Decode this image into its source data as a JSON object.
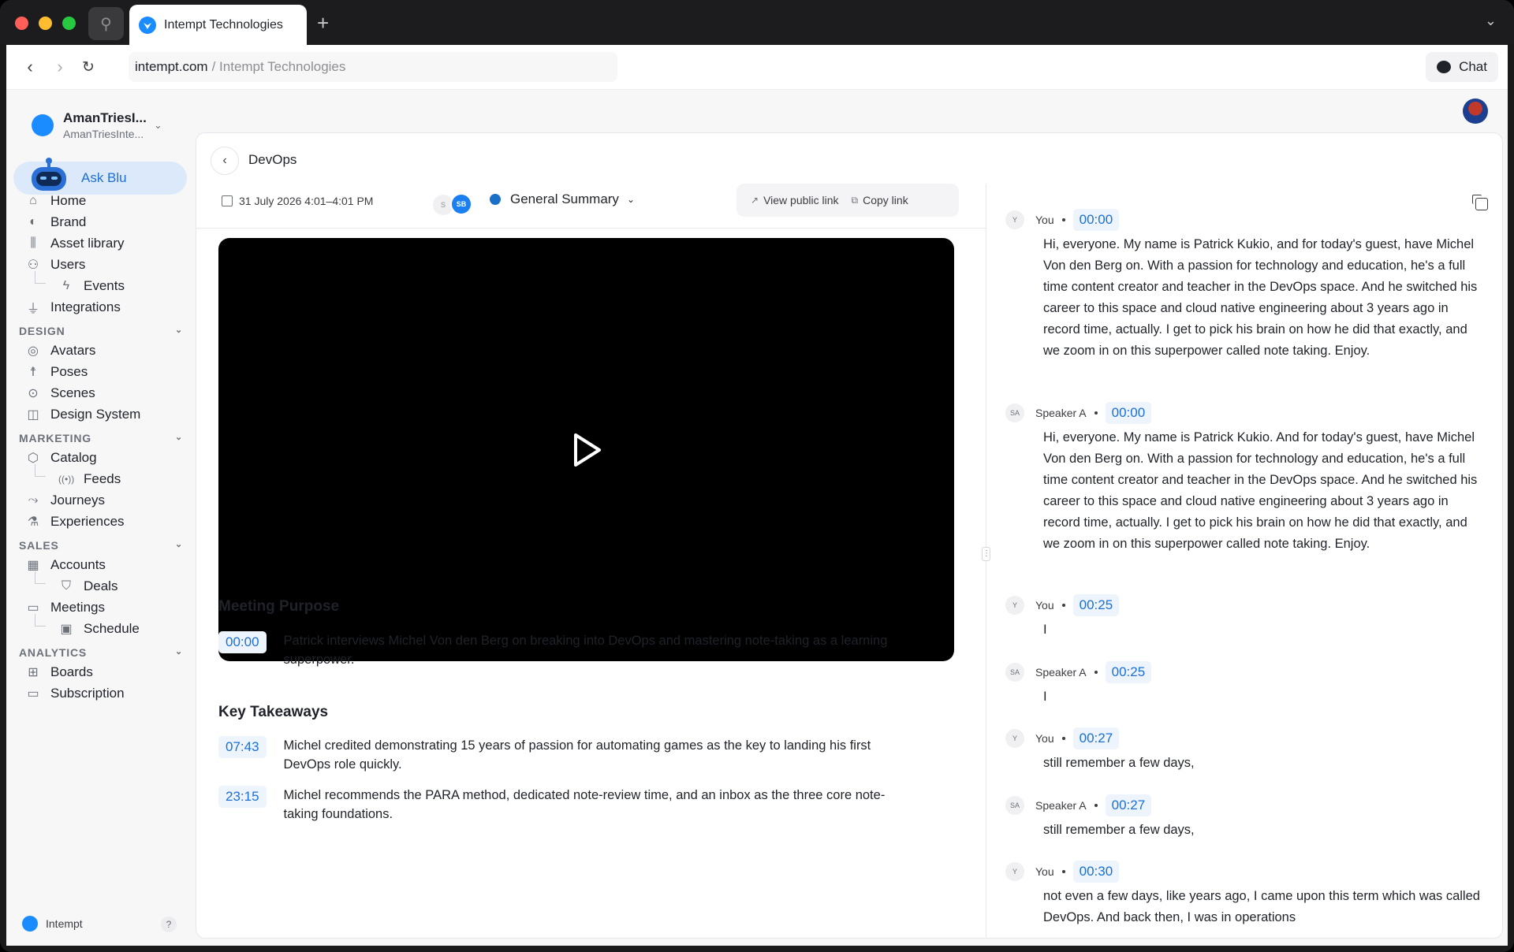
{
  "browser": {
    "tab_title": "Intempt Technologies",
    "url_host": "intempt.com",
    "url_path": "/ Intempt Technologies",
    "chat_label": "Chat"
  },
  "workspace": {
    "name": "AmanTriesI...",
    "sub": "AmanTriesInte..."
  },
  "ask_label": "Ask Blu",
  "nav": {
    "home": "Home",
    "brand": "Brand",
    "asset_library": "Asset library",
    "users": "Users",
    "events": "Events",
    "integrations": "Integrations",
    "design_section": "DESIGN",
    "avatars": "Avatars",
    "poses": "Poses",
    "scenes": "Scenes",
    "design_system": "Design System",
    "marketing_section": "MARKETING",
    "catalog": "Catalog",
    "feeds": "Feeds",
    "journeys": "Journeys",
    "experiences": "Experiences",
    "sales_section": "SALES",
    "accounts": "Accounts",
    "deals": "Deals",
    "meetings": "Meetings",
    "schedule": "Schedule",
    "analytics_section": "ANALYTICS",
    "boards": "Boards",
    "subscription": "Subscription"
  },
  "footer": {
    "brand": "Intempt",
    "help": "?"
  },
  "page": {
    "breadcrumb": "DevOps",
    "date": "31 July 2026 4:01–4:01 PM",
    "avatar1": "S",
    "avatar2": "SB",
    "summary_label": "General Summary",
    "view_public_link": "View public link",
    "copy_link": "Copy link"
  },
  "meeting_purpose": {
    "title": "Meeting Purpose",
    "items": [
      {
        "ts": "00:00",
        "text": "Patrick interviews Michel Von den Berg on breaking into DevOps and mastering note-taking as a learning superpower."
      }
    ]
  },
  "key_takeaways": {
    "title": "Key Takeaways",
    "items": [
      {
        "ts": "07:43",
        "text": "Michel credited demonstrating 15 years of passion for automating games as the key to landing his first DevOps role quickly."
      },
      {
        "ts": "23:15",
        "text": "Michel recommends the PARA method, dedicated note-review time, and an inbox as the three core note-taking foundations."
      }
    ]
  },
  "transcript": [
    {
      "avatar": "Y",
      "speaker": "You",
      "ts": "00:00",
      "text": "Hi, everyone. My name is Patrick Kukio, and for today's guest, have Michel Von den Berg on. With a passion for technology and education, he's a full time content creator and teacher in the DevOps space. And he switched his career to this space and cloud native engineering about 3 years ago in record time, actually. I get to pick his brain on how he did that exactly, and we zoom in on this superpower called note taking. Enjoy."
    },
    {
      "avatar": "SA",
      "speaker": "Speaker A",
      "ts": "00:00",
      "text": "Hi, everyone. My name is Patrick Kukio. And for today's guest, have Michel Von den Berg on. With a passion for technology and education, he's a full time content creator and teacher in the DevOps space. And he switched his career to this space and cloud native engineering about 3 years ago in record time, actually. I get to pick his brain on how he did that exactly, and we zoom in on this superpower called note taking. Enjoy."
    },
    {
      "avatar": "Y",
      "speaker": "You",
      "ts": "00:25",
      "text": "I"
    },
    {
      "avatar": "SA",
      "speaker": "Speaker A",
      "ts": "00:25",
      "text": "I"
    },
    {
      "avatar": "Y",
      "speaker": "You",
      "ts": "00:27",
      "text": "still remember a few days,"
    },
    {
      "avatar": "SA",
      "speaker": "Speaker A",
      "ts": "00:27",
      "text": "still remember a few days,"
    },
    {
      "avatar": "Y",
      "speaker": "You",
      "ts": "00:30",
      "text": "not even a few days, like years ago, I came upon this term which was called DevOps. And back then, I was in operations"
    }
  ]
}
